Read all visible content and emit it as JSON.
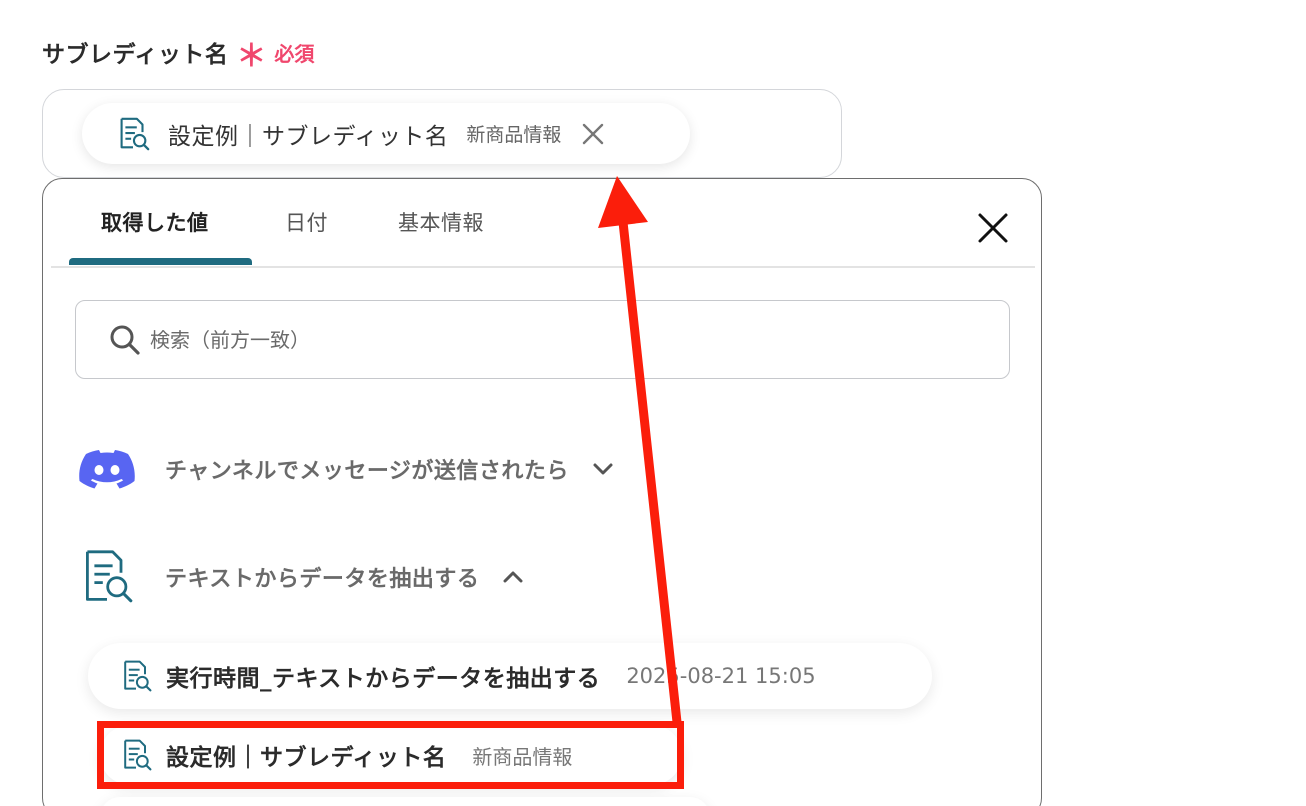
{
  "field": {
    "label": "サブレディット名",
    "required_mark": "＊",
    "required_text": "必須"
  },
  "selected_chip": {
    "text": "設定例｜サブレディット名",
    "value": "新商品情報"
  },
  "tabs": [
    {
      "label": "取得した値",
      "active": true
    },
    {
      "label": "日付",
      "active": false
    },
    {
      "label": "基本情報",
      "active": false
    }
  ],
  "search": {
    "placeholder": "検索（前方一致）"
  },
  "groups": [
    {
      "title": "チャンネルでメッセージが送信されたら",
      "expanded": false,
      "icon": "discord-icon"
    },
    {
      "title": "テキストからデータを抽出する",
      "expanded": true,
      "icon": "document-search-icon"
    }
  ],
  "items": [
    {
      "name": "実行時間_テキストからデータを抽出する",
      "value": "2025-08-21 15:05"
    },
    {
      "name": "設定例｜サブレディット名",
      "value": "新商品情報"
    }
  ],
  "colors": {
    "accent_teal": "#1f6b80",
    "required_pink": "#f0476d",
    "annotation_red": "#fb1e0b",
    "discord_blurple": "#5865f2"
  }
}
